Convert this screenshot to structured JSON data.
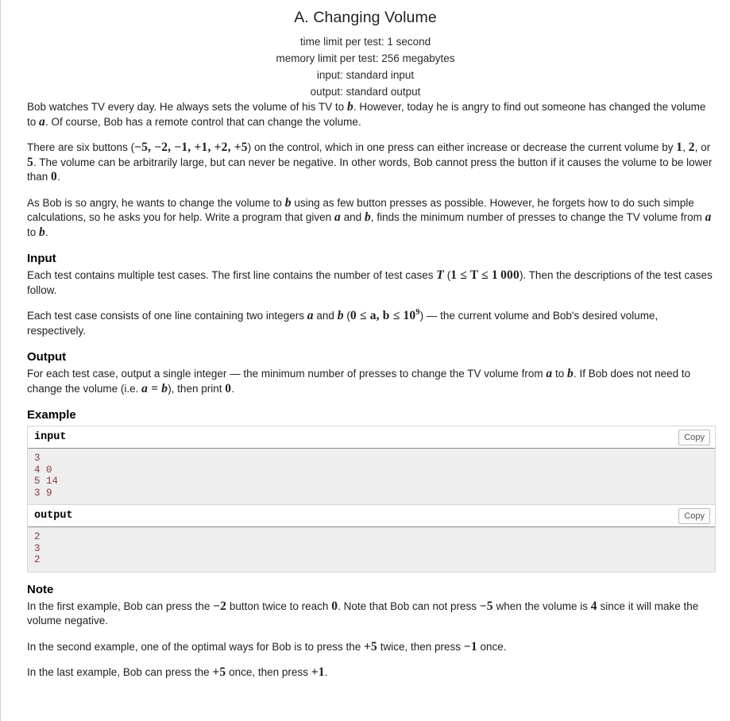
{
  "header": {
    "title": "A. Changing Volume",
    "time_limit": "time limit per test: 1 second",
    "memory_limit": "memory limit per test: 256 megabytes",
    "input_spec": "input: standard input",
    "output_spec": "output: standard output"
  },
  "legend": {
    "p1_a": "Bob watches TV every day. He always sets the volume of his TV to ",
    "p1_b": "b",
    "p1_c": ". However, today he is angry to find out someone has changed the volume to ",
    "p1_d": "a",
    "p1_e": ". Of course, Bob has a remote control that can change the volume.",
    "p2_a": "There are six buttons (",
    "p2_btns": "−5, −2, −1, +1, +2, +5",
    "p2_b": ") on the control, which in one press can either increase or decrease the current volume by ",
    "p2_v1": "1",
    "p2_c": ", ",
    "p2_v2": "2",
    "p2_d": ", or ",
    "p2_v3": "5",
    "p2_e": ". The volume can be arbitrarily large, but can never be negative. In other words, Bob cannot press the button if it causes the volume to be lower than ",
    "p2_zero": "0",
    "p2_f": ".",
    "p3_a": "As Bob is so angry, he wants to change the volume to ",
    "p3_b": "b",
    "p3_c": " using as few button presses as possible. However, he forgets how to do such simple calculations, so he asks you for help. Write a program that given ",
    "p3_d": "a",
    "p3_e": " and ",
    "p3_f": "b",
    "p3_g": ", finds the minimum number of presses to change the TV volume from ",
    "p3_h": "a",
    "p3_i": " to ",
    "p3_j": "b",
    "p3_k": "."
  },
  "input_section": {
    "heading": "Input",
    "p1_a": "Each test contains multiple test cases. The first line contains the number of test cases ",
    "p1_T": "T",
    "p1_b": " (",
    "p1_constraint": "1 ≤ T ≤ 1 000",
    "p1_c": "). Then the descriptions of the test cases follow.",
    "p2_a": "Each test case consists of one line containing two integers ",
    "p2_a_var": "a",
    "p2_b": " and ",
    "p2_b_var": "b",
    "p2_c": " (",
    "p2_constraint_pre": "0 ≤ a, b ≤ 10",
    "p2_constraint_exp": "9",
    "p2_d": ") — the current volume and Bob's desired volume, respectively."
  },
  "output_section": {
    "heading": "Output",
    "p1_a": "For each test case, output a single integer — the minimum number of presses to change the TV volume from ",
    "p1_a_var": "a",
    "p1_b": " to ",
    "p1_b_var": "b",
    "p1_c": ". If Bob does not need to change the volume (i.e. ",
    "p1_eq": "a = b",
    "p1_d": "), then print ",
    "p1_zero": "0",
    "p1_e": "."
  },
  "example": {
    "heading": "Example",
    "input_label": "input",
    "output_label": "output",
    "copy_label": "Copy",
    "input_text": "3\n4 0\n5 14\n3 9",
    "output_text": "2\n3\n2"
  },
  "note_section": {
    "heading": "Note",
    "p1_a": "In the first example, Bob can press the ",
    "p1_m1": "−2",
    "p1_b": " button twice to reach ",
    "p1_m2": "0",
    "p1_c": ". Note that Bob can not press ",
    "p1_m3": "−5",
    "p1_d": " when the volume is ",
    "p1_m4": "4",
    "p1_e": " since it will make the volume negative.",
    "p2_a": "In the second example, one of the optimal ways for Bob is to press the ",
    "p2_m1": "+5",
    "p2_b": " twice, then press ",
    "p2_m2": "−1",
    "p2_c": " once.",
    "p3_a": "In the last example, Bob can press the ",
    "p3_m1": "+5",
    "p3_b": " once, then press ",
    "p3_m2": "+1",
    "p3_c": "."
  }
}
